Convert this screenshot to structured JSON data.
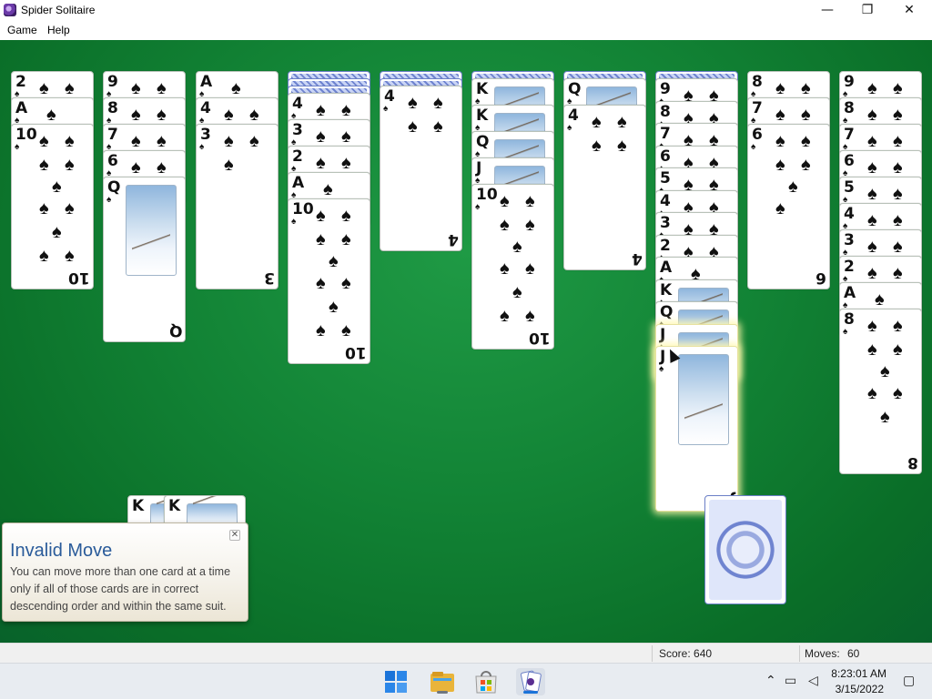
{
  "window": {
    "title": "Spider Solitaire",
    "icon": "spider-icon"
  },
  "window_controls": {
    "minimize": "—",
    "maximize": "❐",
    "close": "✕"
  },
  "menu": {
    "game": "Game",
    "help": "Help"
  },
  "suit_symbol": "♠",
  "tableau": [
    {
      "hidden": 0,
      "cards": [
        "2",
        "A",
        "10"
      ]
    },
    {
      "hidden": 0,
      "cards": [
        "9",
        "8",
        "7",
        "6",
        "Q"
      ]
    },
    {
      "hidden": 0,
      "cards": [
        "A",
        "4",
        "3"
      ]
    },
    {
      "hidden": 3,
      "cards": [
        "4",
        "3",
        "2",
        "A",
        "10"
      ]
    },
    {
      "hidden": 2,
      "cards": [
        "4"
      ]
    },
    {
      "hidden": 1,
      "cards": [
        "K",
        "K",
        "Q",
        "J",
        "10"
      ]
    },
    {
      "hidden": 1,
      "cards": [
        "Q",
        "4"
      ]
    },
    {
      "hidden": 1,
      "cards": [
        "9",
        "8",
        "7",
        "6",
        "5",
        "4",
        "3",
        "2",
        "A",
        "K",
        "Q",
        "J",
        "J"
      ]
    },
    {
      "hidden": 0,
      "cards": [
        "8",
        "7",
        "6"
      ]
    },
    {
      "hidden": 0,
      "cards": [
        "9",
        "8",
        "7",
        "6",
        "5",
        "4",
        "3",
        "2",
        "A",
        "8"
      ]
    }
  ],
  "foundation": [
    "K",
    "K"
  ],
  "stock": {
    "piles": 1
  },
  "toast": {
    "title": "Invalid Move",
    "body": "You can move more than one card at a time only if all of those cards are in correct descending order and within the same suit.",
    "close": "✕"
  },
  "status": {
    "score_label": "Score: 640",
    "moves_label": "Moves:",
    "moves_value": "60"
  },
  "taskbar": {
    "time": "8:23:01 AM",
    "date": "3/15/2022",
    "icons": [
      "windows-start-icon",
      "file-explorer-icon",
      "microsoft-store-icon",
      "spider-solitaire-icon"
    ]
  },
  "colors": {
    "felt": "#128335",
    "accent": "#2a5b9a"
  }
}
